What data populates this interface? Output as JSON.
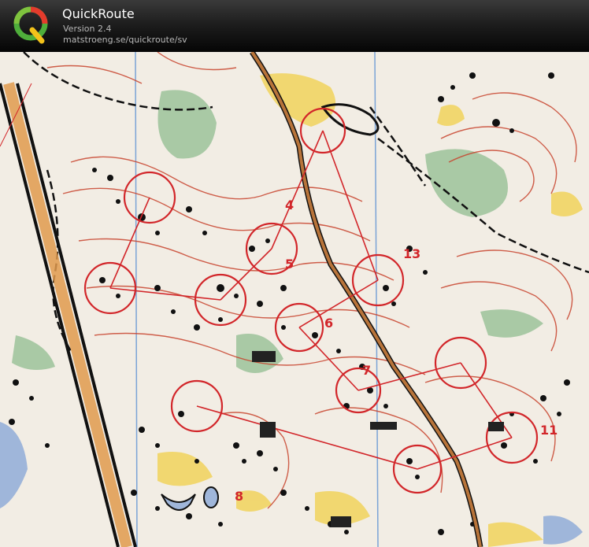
{
  "app": {
    "title": "QuickRoute",
    "version": "Version 2.4",
    "url": "matstroeng.se/quickroute/sv"
  },
  "logo": {
    "letter": "Q"
  },
  "map": {
    "control_numbers": [
      "4",
      "5",
      "6",
      "7",
      "8",
      "11",
      "13"
    ]
  },
  "colors": {
    "header_bg": "#1e1e1e",
    "title_text": "#ffffff",
    "subtitle_text": "#b8b8b8",
    "map_paper": "#f2ede4",
    "course_red": "#d2262a",
    "contour_brown": "#c8442e",
    "vegetation_green": "#9cc29a",
    "open_yellow": "#f1d25c",
    "water_blue": "#9fb6da",
    "road_brown": "#a0522d"
  }
}
